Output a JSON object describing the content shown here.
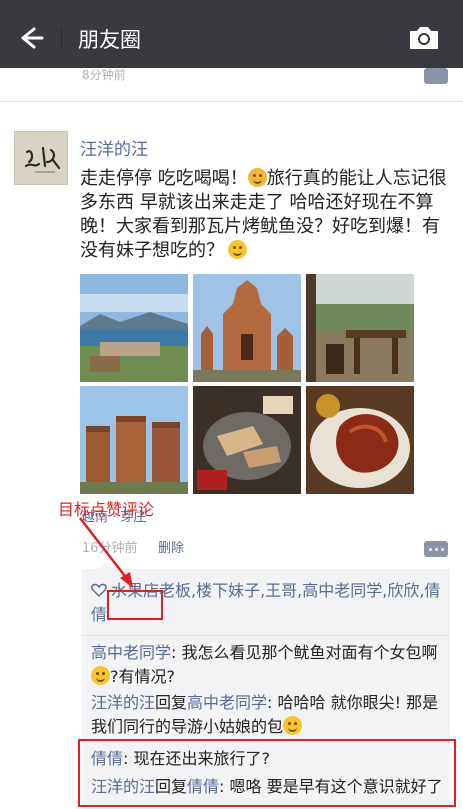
{
  "nav": {
    "title": "朋友圈"
  },
  "prev_post": {
    "time": "8分钟前"
  },
  "post": {
    "author": "汪洋的汪",
    "text_parts": [
      "走走停停 吃吃喝喝！",
      "旅行真的能让人忘记很多东西 早就该出来走走了 哈哈还好现在不算晚！大家看到那瓦片烤鱿鱼没？好吃到爆！有没有妹子想吃的？"
    ],
    "location": "越南 · 芽庄",
    "time": "16分钟前",
    "delete_label": "删除"
  },
  "likes": {
    "names": "水果店老板,楼下妹子,王哥,高中老同学,欣欣,倩倩"
  },
  "comments": [
    {
      "user": "高中老同学",
      "reply_to": "",
      "text_a": "我怎么看见那个鱿鱼对面有个女包啊",
      "text_b": "?有情况?"
    },
    {
      "user": "汪洋的汪",
      "reply_word": "回复",
      "reply_to": "高中老同学",
      "text_a": "哈哈哈 就你眼尖! 那是我们同行的导游小姑娘的包",
      "text_b": ""
    },
    {
      "user": "倩倩",
      "reply_to": "",
      "text_a": "现在还出来旅行了?",
      "text_b": ""
    },
    {
      "user": "汪洋的汪",
      "reply_word": "回复",
      "reply_to": "倩倩",
      "text_a": "嗯咯 要是早有这个意识就好了",
      "text_b": ""
    }
  ],
  "annotation": {
    "label": "目标点赞评论",
    "color": "#e02020"
  },
  "colors": {
    "navbar": "#393a3f",
    "link": "#576b95",
    "comment_bg": "#f3f3f5"
  },
  "icons": [
    "back-arrow-icon",
    "camera-icon",
    "comment-dots-icon",
    "heart-icon",
    "smile-emoji-icon",
    "kiss-emoji-icon"
  ]
}
